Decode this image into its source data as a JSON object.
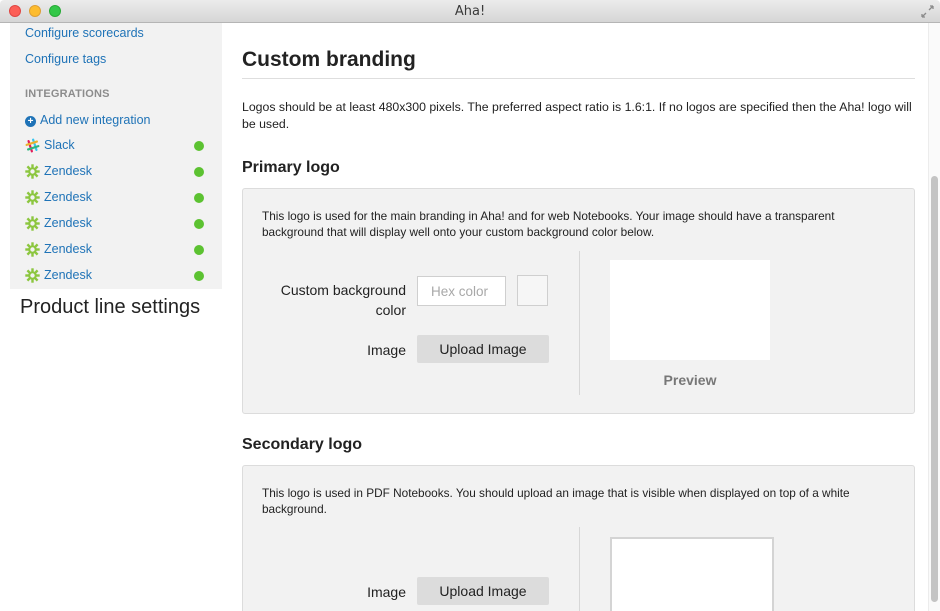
{
  "window": {
    "title": "Aha!"
  },
  "sidebar": {
    "links": [
      {
        "label": "Configure scorecards"
      },
      {
        "label": "Configure tags"
      }
    ],
    "integrations_heading": "INTEGRATIONS",
    "add_integration_label": "Add new integration",
    "integrations": [
      {
        "label": "Slack",
        "icon": "slack-icon",
        "status": "active"
      },
      {
        "label": "Zendesk",
        "icon": "zendesk-icon",
        "status": "active"
      },
      {
        "label": "Zendesk",
        "icon": "zendesk-icon",
        "status": "active"
      },
      {
        "label": "Zendesk",
        "icon": "zendesk-icon",
        "status": "active"
      },
      {
        "label": "Zendesk",
        "icon": "zendesk-icon",
        "status": "active"
      },
      {
        "label": "Zendesk",
        "icon": "zendesk-icon",
        "status": "active"
      }
    ],
    "section_title": "Product line settings"
  },
  "main": {
    "title": "Custom branding",
    "intro": "Logos should be at least 480x300 pixels. The preferred aspect ratio is 1.6:1. If no logos are specified then the Aha! logo will be used.",
    "primary": {
      "title": "Primary logo",
      "description": "This logo is used for the main branding in Aha! and for web Notebooks. Your image should have a transparent background that will display well onto your custom background color below.",
      "bg_color_label": "Custom background color",
      "hex_placeholder": "Hex color",
      "image_label": "Image",
      "upload_label": "Upload Image",
      "preview_label": "Preview"
    },
    "secondary": {
      "title": "Secondary logo",
      "description": "This logo is used in PDF Notebooks. You should upload an image that is visible when displayed on top of a white background.",
      "image_label": "Image",
      "upload_label": "Upload Image"
    }
  },
  "colors": {
    "link": "#1f73b7",
    "status_active": "#5cc231",
    "panel_bg": "#f2f2f2",
    "button_bg": "#dcdcdc"
  }
}
